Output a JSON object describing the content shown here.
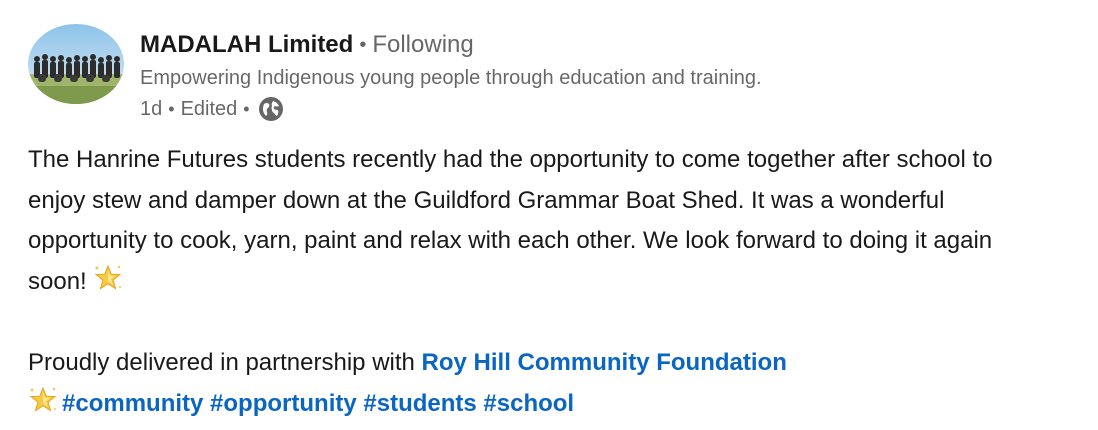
{
  "actor": {
    "name": "MADALAH Limited",
    "separator": "•",
    "follow_status": "Following",
    "description": "Empowering Indigenous young people through education and training.",
    "posted_time": "1d",
    "edited": "Edited",
    "visibility_icon": "globe-icon"
  },
  "post": {
    "body": "The Hanrine Futures students recently had the opportunity to come together after school to enjoy stew and damper down at the Guildford Grammar Boat Shed. It was a wonderful opportunity to cook, yarn, paint and relax with each other. We look forward to doing it again soon!",
    "body_emoji_icon": "glowing-star-icon",
    "partnership_text": "Proudly delivered in partnership with",
    "partner_link": "Roy Hill Community Foundation",
    "lead_emoji_icon": "glowing-star-icon",
    "hashtags": [
      "#community",
      "#opportunity",
      "#students",
      "#school"
    ]
  },
  "colors": {
    "link": "#0a66c2",
    "secondary_text": "#666666",
    "primary_text": "#1a1a1a"
  }
}
